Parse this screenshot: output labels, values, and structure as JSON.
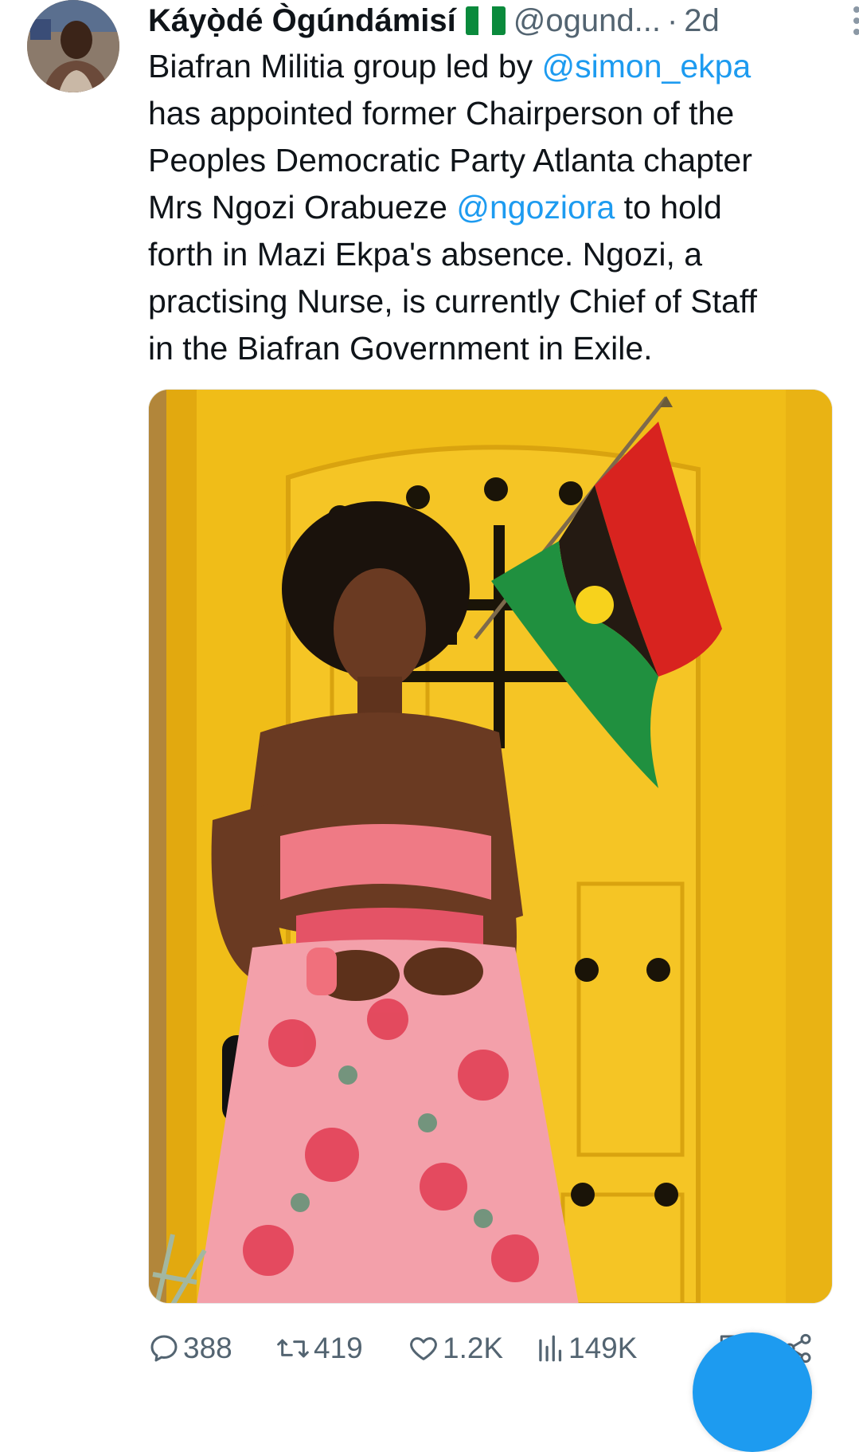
{
  "tweet": {
    "author": {
      "display_name": "Káyọ̀dé Ògúndámisí",
      "handle": "@ogund...",
      "flag_icon": "nigeria-flag-icon",
      "avatar_icon": "user-avatar"
    },
    "separator": "·",
    "timestamp": "2d",
    "more_icon": "more-vertical-icon",
    "text_segments": [
      {
        "type": "text",
        "value": "Biafran Militia group led by "
      },
      {
        "type": "mention",
        "value": "@simon_ekpa"
      },
      {
        "type": "text",
        "value": "\nhas appointed former Chairperson of the\nPeoples Democratic Party Atlanta chapter\nMrs Ngozi Orabueze "
      },
      {
        "type": "mention",
        "value": "@ngoziora"
      },
      {
        "type": "text",
        "value": " to hold\nforth in Mazi Ekpa's absence. Ngozi, a\npractising Nurse, is currently Chief of Staff\nin the Biafran Government in Exile."
      }
    ],
    "media": {
      "type": "photo",
      "image_icon": "photo-woman-yellow-door-biafra-flag"
    },
    "actions": {
      "replies": {
        "icon": "reply-icon",
        "count": "388"
      },
      "reposts": {
        "icon": "repost-icon",
        "count": "419"
      },
      "likes": {
        "icon": "heart-icon",
        "count": "1.2K"
      },
      "views": {
        "icon": "views-icon",
        "count": "149K"
      },
      "bookmark": {
        "icon": "bookmark-icon"
      },
      "share": {
        "icon": "share-icon"
      }
    }
  },
  "colors": {
    "text": "#0f1419",
    "secondary": "#536471",
    "link": "#1d9bf0",
    "accent": "#1d9bf0"
  }
}
